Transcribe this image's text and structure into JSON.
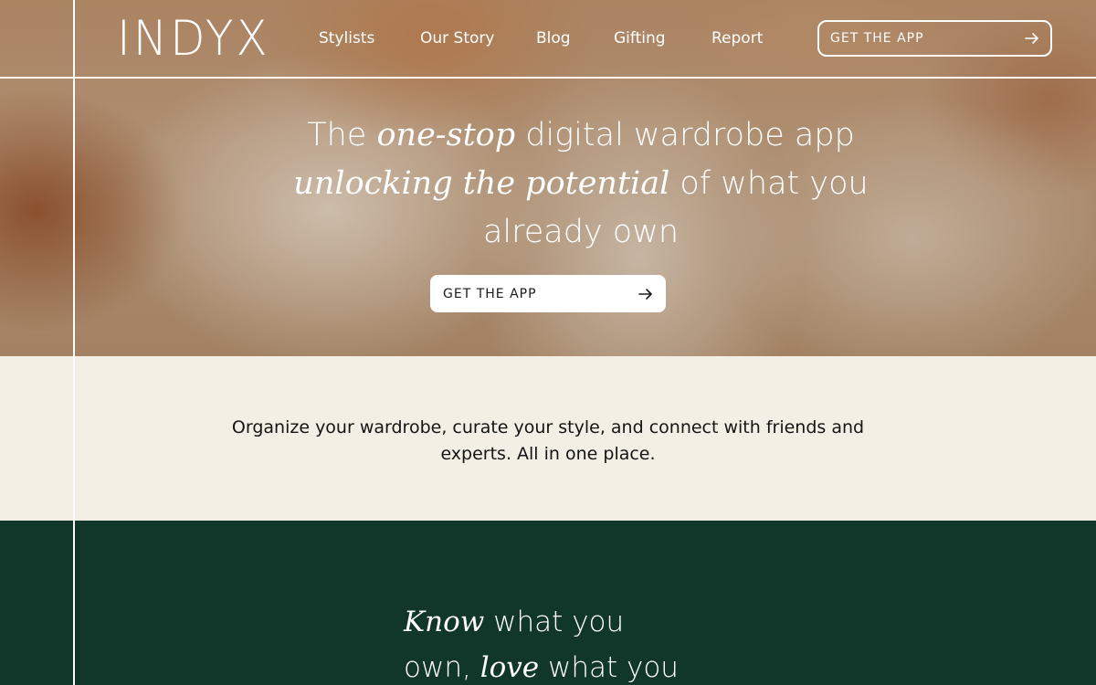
{
  "header": {
    "logo": "INDYX",
    "nav": [
      "Stylists",
      "Our Story",
      "Blog",
      "Gifting",
      "Report"
    ],
    "cta_label": "GET THE APP"
  },
  "hero": {
    "line1_pre": "The ",
    "line1_em": "one-stop",
    "line1_post": " digital wardrobe app",
    "line2_em": "unlocking the potential",
    "line2_post": " of what you",
    "line3": "already own",
    "cta_label": "GET THE APP"
  },
  "intro": {
    "text": "Organize your wardrobe, curate your style, and connect with friends and experts. All in one place."
  },
  "feature": {
    "em1": "Know",
    "t1": " what you",
    "t2": "own, ",
    "em2": "love",
    "t3": " what you"
  },
  "colors": {
    "cream": "#f3efe4",
    "forest_green": "#11362a",
    "white": "#ffffff"
  },
  "icons": [
    "arrow-right-icon"
  ]
}
